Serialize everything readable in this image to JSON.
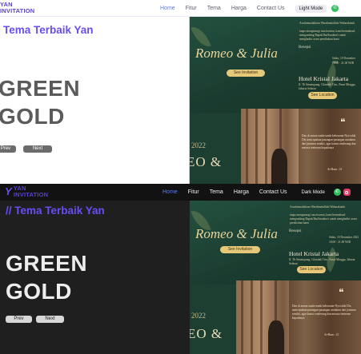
{
  "light": {
    "brand": {
      "line1": "YAN",
      "line2": "INVITATION"
    },
    "nav": {
      "links": [
        {
          "label": "Home",
          "active": true
        },
        {
          "label": "Fitur",
          "active": false
        },
        {
          "label": "Tema",
          "active": false
        },
        {
          "label": "Harga",
          "active": false
        },
        {
          "label": "Contact Us",
          "active": false
        }
      ],
      "mode_label": "Light Mode",
      "icons": [
        "whatsapp-icon"
      ]
    },
    "heading": "Tema Terbaik Yan",
    "theme_line1": "GREEN",
    "theme_line2": "GOLD",
    "prev_label": "Prev",
    "next_label": "Next"
  },
  "dark": {
    "brand": {
      "line1": "YAN",
      "line2": "INVITATION"
    },
    "nav": {
      "links": [
        {
          "label": "Home",
          "active": true
        },
        {
          "label": "Fitur",
          "active": false
        },
        {
          "label": "Tema",
          "active": false
        },
        {
          "label": "Harga",
          "active": false
        },
        {
          "label": "Contact Us",
          "active": false
        }
      ],
      "mode_label": "Dark Mode",
      "icons": [
        "whatsapp-icon",
        "instagram-icon"
      ]
    },
    "heading": "// Tema Terbaik Yan",
    "theme_line1": "GREEN",
    "theme_line2": "GOLD",
    "prev_label": "Prev",
    "next_label": "Next"
  },
  "preview": {
    "couple_names": "Romeo & Julia",
    "see_invitation": "See Invitation",
    "venue": "Hotel Kristal Jakarta",
    "see_location": "See Location",
    "year": "2022",
    "initials": "EO &",
    "resepsi_label": "Resepsi",
    "date_text": "Sabtu, 19 Desember 2022",
    "time_text": "18.00 - 21.00 WIB",
    "greeting": "Assalamualaikum Warahmatullahi Wabarakatuh",
    "intro_text": "tanpa mengurangi rasa hormat, kami bermaksud mengundang Bapak/Ibu/Saudara/i untuk menghadiri acara pernikahan kami",
    "address_text": "Jl. Tb Simatupang, Cilandak Tim., Pasar Minggu, Jakarta Selatan",
    "quote_mark": "❝",
    "quote_text": "Dan di antara tanda-tanda kebesaran-Nya ialah Dia menciptakan pasangan-pasangan untukmu dari jenismu sendiri, agar kamu cenderung dan merasa tenteram kepadanya",
    "quote_source": "Ar-Rum : 21",
    "colors": {
      "green": "#1e4234",
      "gold": "#e7c778"
    }
  },
  "colors": {
    "accent": "#6a4cf2",
    "active_link": "#5b7cf0"
  }
}
